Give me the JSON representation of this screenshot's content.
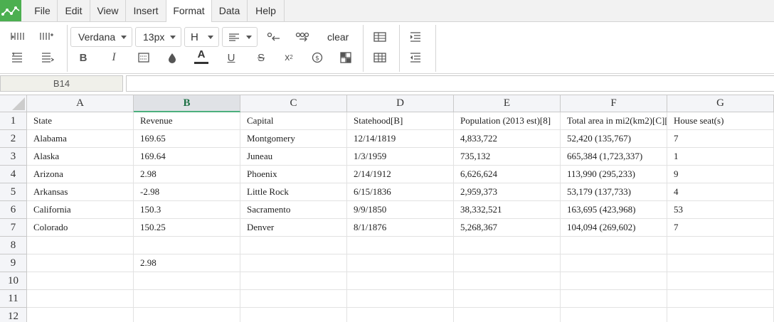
{
  "menu": {
    "items": [
      "File",
      "Edit",
      "View",
      "Insert",
      "Format",
      "Data",
      "Help"
    ],
    "active": "Format"
  },
  "toolbar": {
    "font_family": "Verdana",
    "font_size": "13px",
    "clear_label": "clear",
    "icons": {
      "row1": [
        "insert-row-above-icon",
        "insert-column-icon",
        "borders-icon",
        "align-left-icon",
        "decrease-decimal-icon",
        "increase-decimal-icon",
        "table-icon",
        "indent-icon"
      ],
      "row2": [
        "insert-row-below-icon",
        "delete-row-icon",
        "bold-icon",
        "italic-icon",
        "wrap-text-icon",
        "fill-color-icon",
        "text-color-icon",
        "underline-icon",
        "strikethrough-icon",
        "superscript-icon",
        "currency-icon",
        "merge-cells-icon",
        "table-grid-icon",
        "outdent-icon"
      ]
    },
    "text_color_bar": "#333333"
  },
  "formula_bar": {
    "cell_ref": "B14",
    "value": ""
  },
  "sheet": {
    "columns": [
      "A",
      "B",
      "C",
      "D",
      "E",
      "F",
      "G"
    ],
    "selected_column": "B",
    "row_numbers": [
      "1",
      "2",
      "3",
      "4",
      "5",
      "6",
      "7",
      "8",
      "9",
      "10",
      "11",
      "12"
    ],
    "rows": [
      [
        "State",
        "Revenue",
        "Capital",
        "Statehood[B]",
        "Population (2013 est)[8]",
        "Total area in mi2(km2)[C][",
        "House seat(s)"
      ],
      [
        "Alabama",
        "169.65",
        "Montgomery",
        "12/14/1819",
        "4,833,722",
        "52,420 (135,767)",
        "7"
      ],
      [
        "Alaska",
        "169.64",
        "Juneau",
        "1/3/1959",
        "735,132",
        "665,384 (1,723,337)",
        "1"
      ],
      [
        "Arizona",
        "2.98",
        "Phoenix",
        "2/14/1912",
        "6,626,624",
        "113,990 (295,233)",
        "9"
      ],
      [
        "Arkansas",
        "-2.98",
        "Little Rock",
        "6/15/1836",
        "2,959,373",
        "53,179 (137,733)",
        "4"
      ],
      [
        "California",
        "150.3",
        "Sacramento",
        "9/9/1850",
        "38,332,521",
        "163,695 (423,968)",
        "53"
      ],
      [
        "Colorado",
        "150.25",
        "Denver",
        "8/1/1876",
        "5,268,367",
        "104,094 (269,602)",
        "7"
      ],
      [
        "",
        "",
        "",
        "",
        "",
        "",
        ""
      ],
      [
        "",
        "2.98",
        "",
        "",
        "",
        "",
        ""
      ],
      [
        "",
        "",
        "",
        "",
        "",
        "",
        ""
      ],
      [
        "",
        "",
        "",
        "",
        "",
        "",
        ""
      ],
      [
        "",
        "",
        "",
        "",
        "",
        "",
        ""
      ]
    ]
  },
  "colors": {
    "accent": "#4caf50",
    "selected_header_text": "#1e7145"
  }
}
